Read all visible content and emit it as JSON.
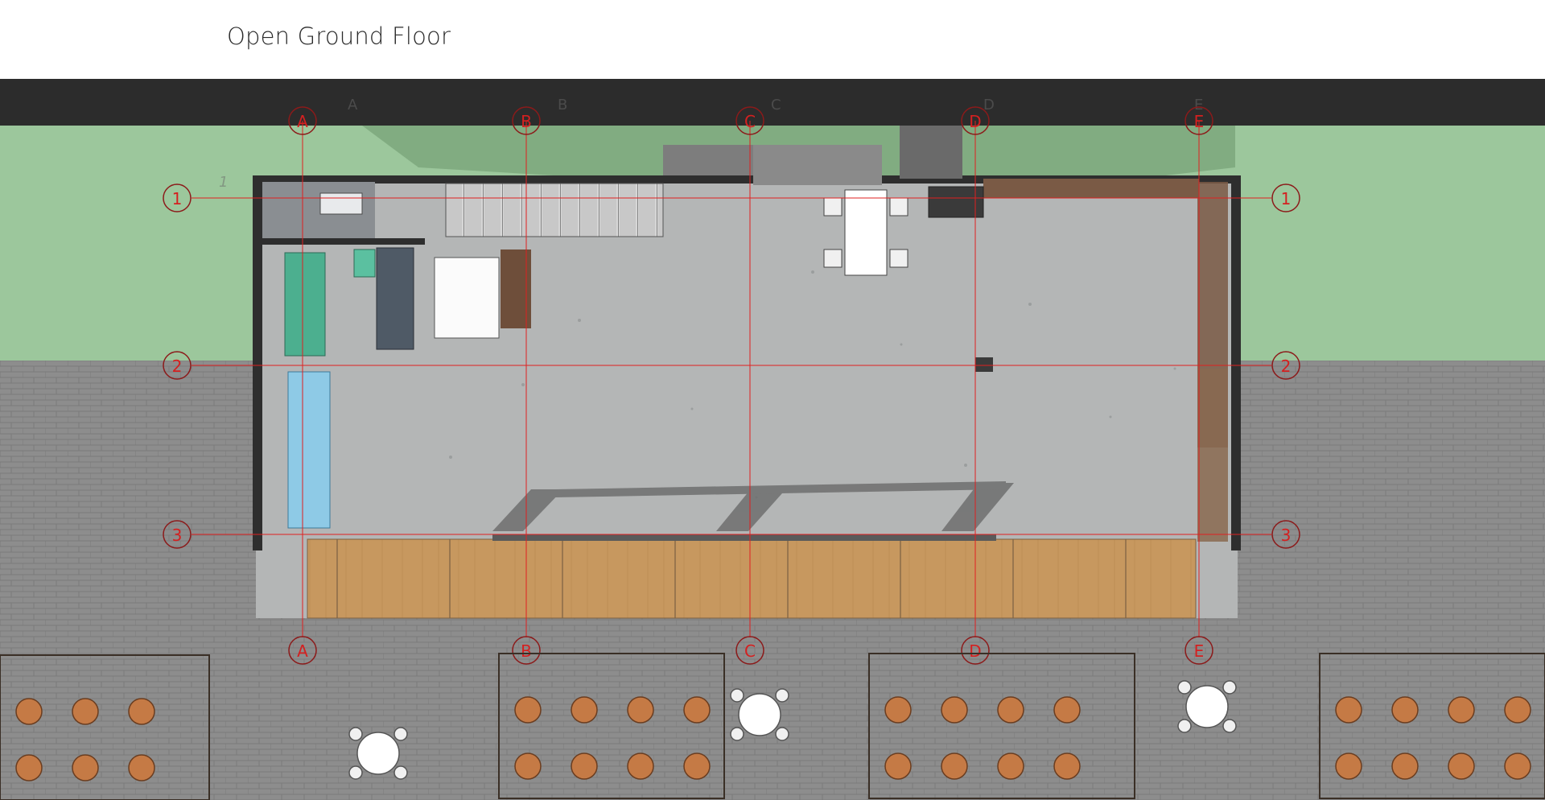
{
  "page": {
    "title": "Open Ground Floor"
  },
  "grid_columns": [
    "A",
    "B",
    "C",
    "D",
    "E"
  ],
  "grid_rows": [
    "1",
    "2",
    "3"
  ],
  "colors": {
    "title_text": "#2a2a2a",
    "top_band": "#2c2c2c",
    "lawn": "#9cc79c",
    "paving": "#8f8f8f",
    "floor_slab": "#b4b6b6",
    "deck": "#c89a66",
    "grid_line": "#e02020",
    "grid_bubble": "#d42020"
  },
  "icons": {
    "grid_bubble": "grid-bubble-icon",
    "furniture": "table-chair-icon",
    "planter": "planter-icon",
    "stair": "stair-icon"
  }
}
